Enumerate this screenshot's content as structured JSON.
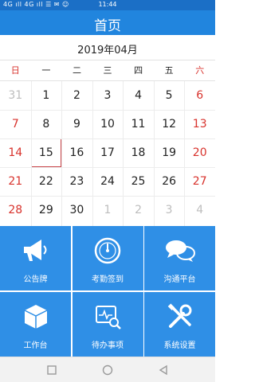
{
  "status_bar": {
    "left_text": "4G ıll  4G ıll  ☰ ✉ ☺",
    "time": "11:44"
  },
  "header": {
    "title": "首页"
  },
  "calendar": {
    "month_label": "2019年04月",
    "weekdays": [
      "日",
      "一",
      "二",
      "三",
      "四",
      "五",
      "六"
    ],
    "weeks": [
      [
        "31",
        "1",
        "2",
        "3",
        "4",
        "5",
        "6"
      ],
      [
        "7",
        "8",
        "9",
        "10",
        "11",
        "12",
        "13"
      ],
      [
        "14",
        "15",
        "16",
        "17",
        "18",
        "19",
        "20"
      ],
      [
        "21",
        "22",
        "23",
        "24",
        "25",
        "26",
        "27"
      ],
      [
        "28",
        "29",
        "30",
        "1",
        "2",
        "3",
        "4"
      ]
    ],
    "selected_day": "15",
    "colors": {
      "weekend": "#d8322c",
      "outside_month": "#bdbdbd",
      "selected_border": "#c9464a"
    }
  },
  "menu": {
    "tiles": [
      {
        "label": "公告牌",
        "icon": "megaphone-icon"
      },
      {
        "label": "考勤签到",
        "icon": "gauge-icon"
      },
      {
        "label": "沟通平台",
        "icon": "chat-bubbles-icon"
      },
      {
        "label": "工作台",
        "icon": "cube-icon"
      },
      {
        "label": "待办事项",
        "icon": "monitor-search-icon"
      },
      {
        "label": "系统设置",
        "icon": "tools-icon"
      }
    ],
    "colors": {
      "tile": "#2f8fe6",
      "header": "#2185de"
    }
  },
  "nav": {
    "buttons": [
      "recent-apps-icon",
      "home-icon",
      "back-icon"
    ]
  }
}
